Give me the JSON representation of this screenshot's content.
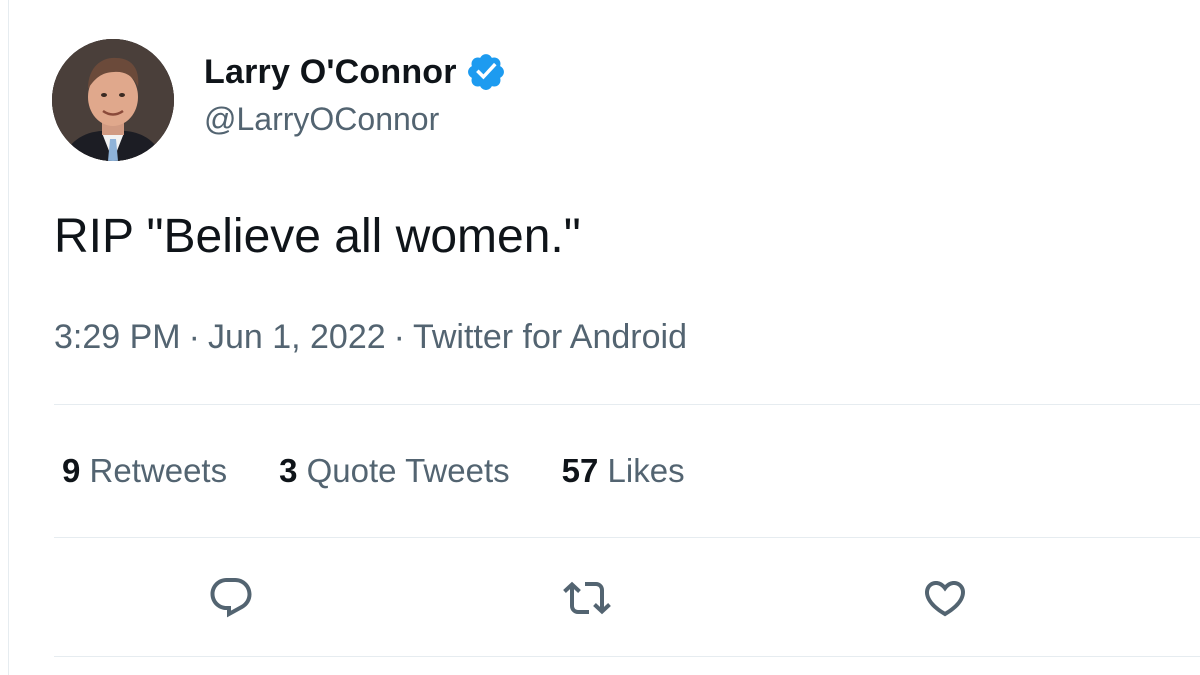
{
  "tweet": {
    "author": {
      "display_name": "Larry O'Connor",
      "handle": "@LarryOConnor",
      "verified": true,
      "avatar_icon": "profile-photo"
    },
    "text": "RIP \"Believe all women.\"",
    "time": "3:29 PM",
    "date": "Jun 1, 2022",
    "separator": "·",
    "source": "Twitter for Android"
  },
  "stats": {
    "retweets_count": "9",
    "retweets_label": "Retweets",
    "quotes_count": "3",
    "quotes_label": "Quote Tweets",
    "likes_count": "57",
    "likes_label": "Likes"
  },
  "actions": [
    {
      "icon": "reply-icon"
    },
    {
      "icon": "retweet-icon"
    },
    {
      "icon": "like-icon"
    }
  ],
  "colors": {
    "text_primary": "#0f1419",
    "text_secondary": "#536471",
    "verified_blue": "#1d9bf0",
    "divider": "#e6ecf0"
  }
}
